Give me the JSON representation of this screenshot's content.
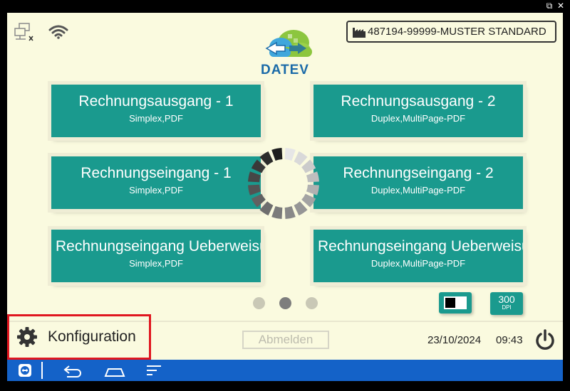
{
  "header": {
    "device_label": "487194-99999-MUSTER STANDARD",
    "logo_text": "DATEV"
  },
  "icons": {
    "network": "network-disconnected-icon",
    "wifi": "wifi-icon",
    "factory": "factory-icon",
    "gear": "gear-icon",
    "power": "power-icon"
  },
  "profiles": [
    {
      "name": "Rechnungsausgang - 1",
      "settings": "Simplex,PDF"
    },
    {
      "name": "Rechnungsausgang - 2",
      "settings": "Duplex,MultiPage-PDF"
    },
    {
      "name": "Rechnungseingang - 1",
      "settings": "Simplex,PDF"
    },
    {
      "name": "Rechnungseingang - 2",
      "settings": "Duplex,MultiPage-PDF"
    },
    {
      "name": "Rechnungseingang Ueberweisung",
      "settings": "Simplex,PDF"
    },
    {
      "name": "Rechnungseingang Ueberweisung",
      "settings": "Duplex,MultiPage-PDF"
    }
  ],
  "pagination": {
    "pages": 3,
    "current": 2
  },
  "scan_settings": {
    "dpi_value": "300",
    "dpi_unit": "DPI"
  },
  "footer": {
    "config_label": "Konfiguration",
    "logout_label": "Abmelden",
    "date": "23/10/2024",
    "time": "09:43"
  },
  "colors": {
    "accent": "#1a9a8e",
    "background": "#fafadf",
    "navbar": "#1462c8",
    "highlight": "#e0161f"
  }
}
